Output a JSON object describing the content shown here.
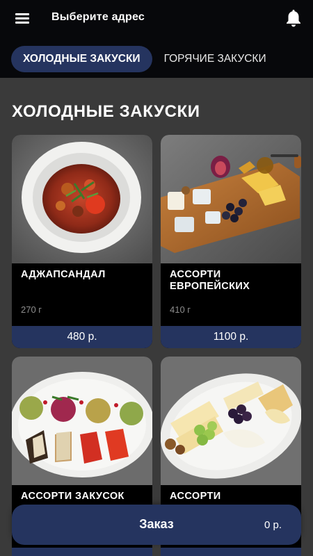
{
  "header": {
    "address_label": "Выберите адрес",
    "menu_icon": "hamburger-menu-icon",
    "bell_icon": "bell-icon"
  },
  "tabs": [
    {
      "label": "ХОЛОДНЫЕ ЗАКУСКИ",
      "active": true
    },
    {
      "label": "ГОРЯЧИЕ ЗАКУСКИ",
      "active": false
    }
  ],
  "section": {
    "title": "ХОЛОДНЫЕ ЗАКУСКИ"
  },
  "products": [
    {
      "name": "АДЖАПСАНДАЛ",
      "weight": "270 г",
      "price": "480 р."
    },
    {
      "name": "АССОРТИ ЕВРОПЕЙСКИХ",
      "weight": "410 г",
      "price": "1100 р."
    },
    {
      "name": "АССОРТИ ЗАКУСОК",
      "weight": "",
      "price": ""
    },
    {
      "name": "АССОРТИ",
      "weight": "",
      "price": ""
    }
  ],
  "order": {
    "label": "Заказ",
    "total": "0 р."
  },
  "colors": {
    "accent": "#25345f",
    "header_bg": "#07080b",
    "page_bg": "#3a3a3a"
  }
}
